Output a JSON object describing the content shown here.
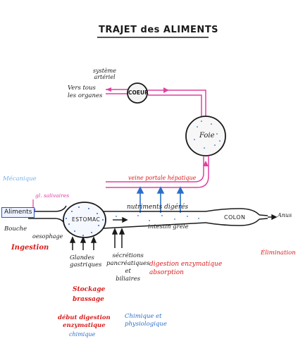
{
  "title": "TRAJET des ALIMENTS",
  "labels": {
    "systeme_arteriel": "système\nartériel",
    "vers_organes": "Vers tous\nles organes",
    "coeur": "COEUR",
    "foie": "Foie",
    "veine_porte": "veine portale hépatique",
    "mecanique": "Mécanique",
    "gout_salivaires": "gl. salivaires",
    "aliments": "Aliments",
    "bouche": "Bouche",
    "oesophage": "oesophage",
    "estomac": "ESTOMAC",
    "nutriments": "nutriments digérés",
    "intestin": "intestin grêle",
    "colon": "COLON",
    "anus": "Anus",
    "ingestion": "Ingestion",
    "glandes": "Glandes\ngastriques",
    "secretions": "sécrétions\npancréatiques\net\nbiliaires",
    "digestion_enz": "digestion enzymatique\nabsorption",
    "elimination": "Élimination",
    "stockage": "Stockage\nbrassage",
    "debut_digestion": "début digestion\nenzymatique",
    "chimique_small": "chimique",
    "chimique_physio": "Chimique et\nphysiologique"
  },
  "colors": {
    "ink": "#1a1a1a",
    "red": "#d81b1b",
    "blue": "#2c6fc9",
    "pink": "#e040a0"
  }
}
